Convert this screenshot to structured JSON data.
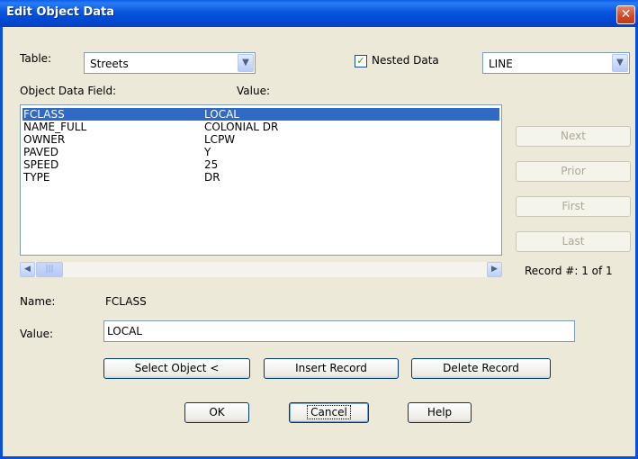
{
  "window": {
    "title": "Edit Object Data",
    "close_glyph": "✕"
  },
  "table": {
    "label": "Table:",
    "value": "Streets"
  },
  "nested": {
    "label": "Nested Data",
    "checked": true,
    "mark": "✓"
  },
  "type_combo": {
    "value": "LINE"
  },
  "columns": {
    "field": "Object Data Field:",
    "value": "Value:"
  },
  "rows": [
    {
      "field": "FCLASS",
      "value": "LOCAL",
      "selected": true
    },
    {
      "field": "NAME_FULL",
      "value": "COLONIAL DR",
      "selected": false
    },
    {
      "field": "OWNER",
      "value": "LCPW",
      "selected": false
    },
    {
      "field": "PAVED",
      "value": "Y",
      "selected": false
    },
    {
      "field": "SPEED",
      "value": "25",
      "selected": false
    },
    {
      "field": "TYPE",
      "value": "DR",
      "selected": false
    }
  ],
  "nav": {
    "next": "Next",
    "prior": "Prior",
    "first": "First",
    "last": "Last"
  },
  "record": "Record #: 1 of 1",
  "name": {
    "label": "Name:",
    "value": "FCLASS"
  },
  "value_field": {
    "label": "Value:",
    "value": "LOCAL"
  },
  "buttons": {
    "select_object": "Select Object <",
    "insert_record": "Insert Record",
    "delete_record": "Delete Record",
    "ok": "OK",
    "cancel": "Cancel",
    "help": "Help"
  },
  "icons": {
    "dropdown": "chevron-down-icon",
    "scroll_left": "arrow-left-icon",
    "scroll_right": "arrow-right-icon",
    "close": "close-icon",
    "check": "check-icon"
  },
  "colors": {
    "titlebar": "#0A55DD",
    "selection": "#316AC5",
    "dialog_bg": "#ECE9D8"
  }
}
